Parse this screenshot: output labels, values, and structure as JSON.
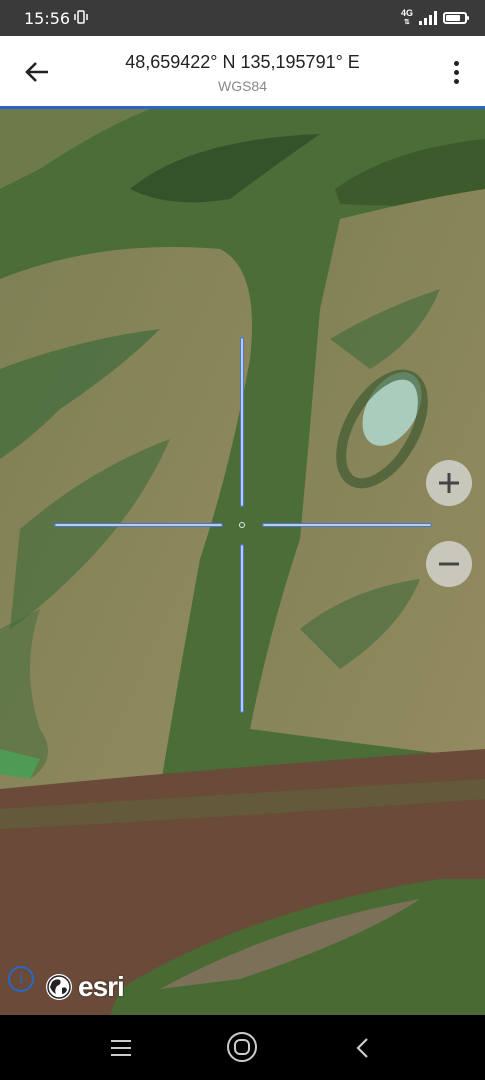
{
  "status_bar": {
    "time": "15:56",
    "network": "4G",
    "network_sub": "⇅",
    "signal_bars": 4,
    "battery_level": 0.75,
    "icons": [
      "vibrate-icon",
      "signal-icon",
      "battery-icon"
    ]
  },
  "app_bar": {
    "title": "48,659422° N 135,195791° E",
    "subtitle": "WGS84",
    "back_icon": "arrow-back-icon",
    "menu_icon": "more-vert-icon"
  },
  "map": {
    "zoom_in_label": "+",
    "zoom_out_label": "−",
    "attribution_icon": "i",
    "logo_text": "esri"
  },
  "fab": {
    "icon": "check-icon"
  },
  "colors": {
    "accent": "#2a67c4",
    "river_green": "#4a6e36",
    "river_brown": "#6a4b3a",
    "land": "#8c8a5e"
  },
  "nav_bar": {
    "icons": [
      "menu-icon",
      "home-icon",
      "back-icon"
    ]
  }
}
